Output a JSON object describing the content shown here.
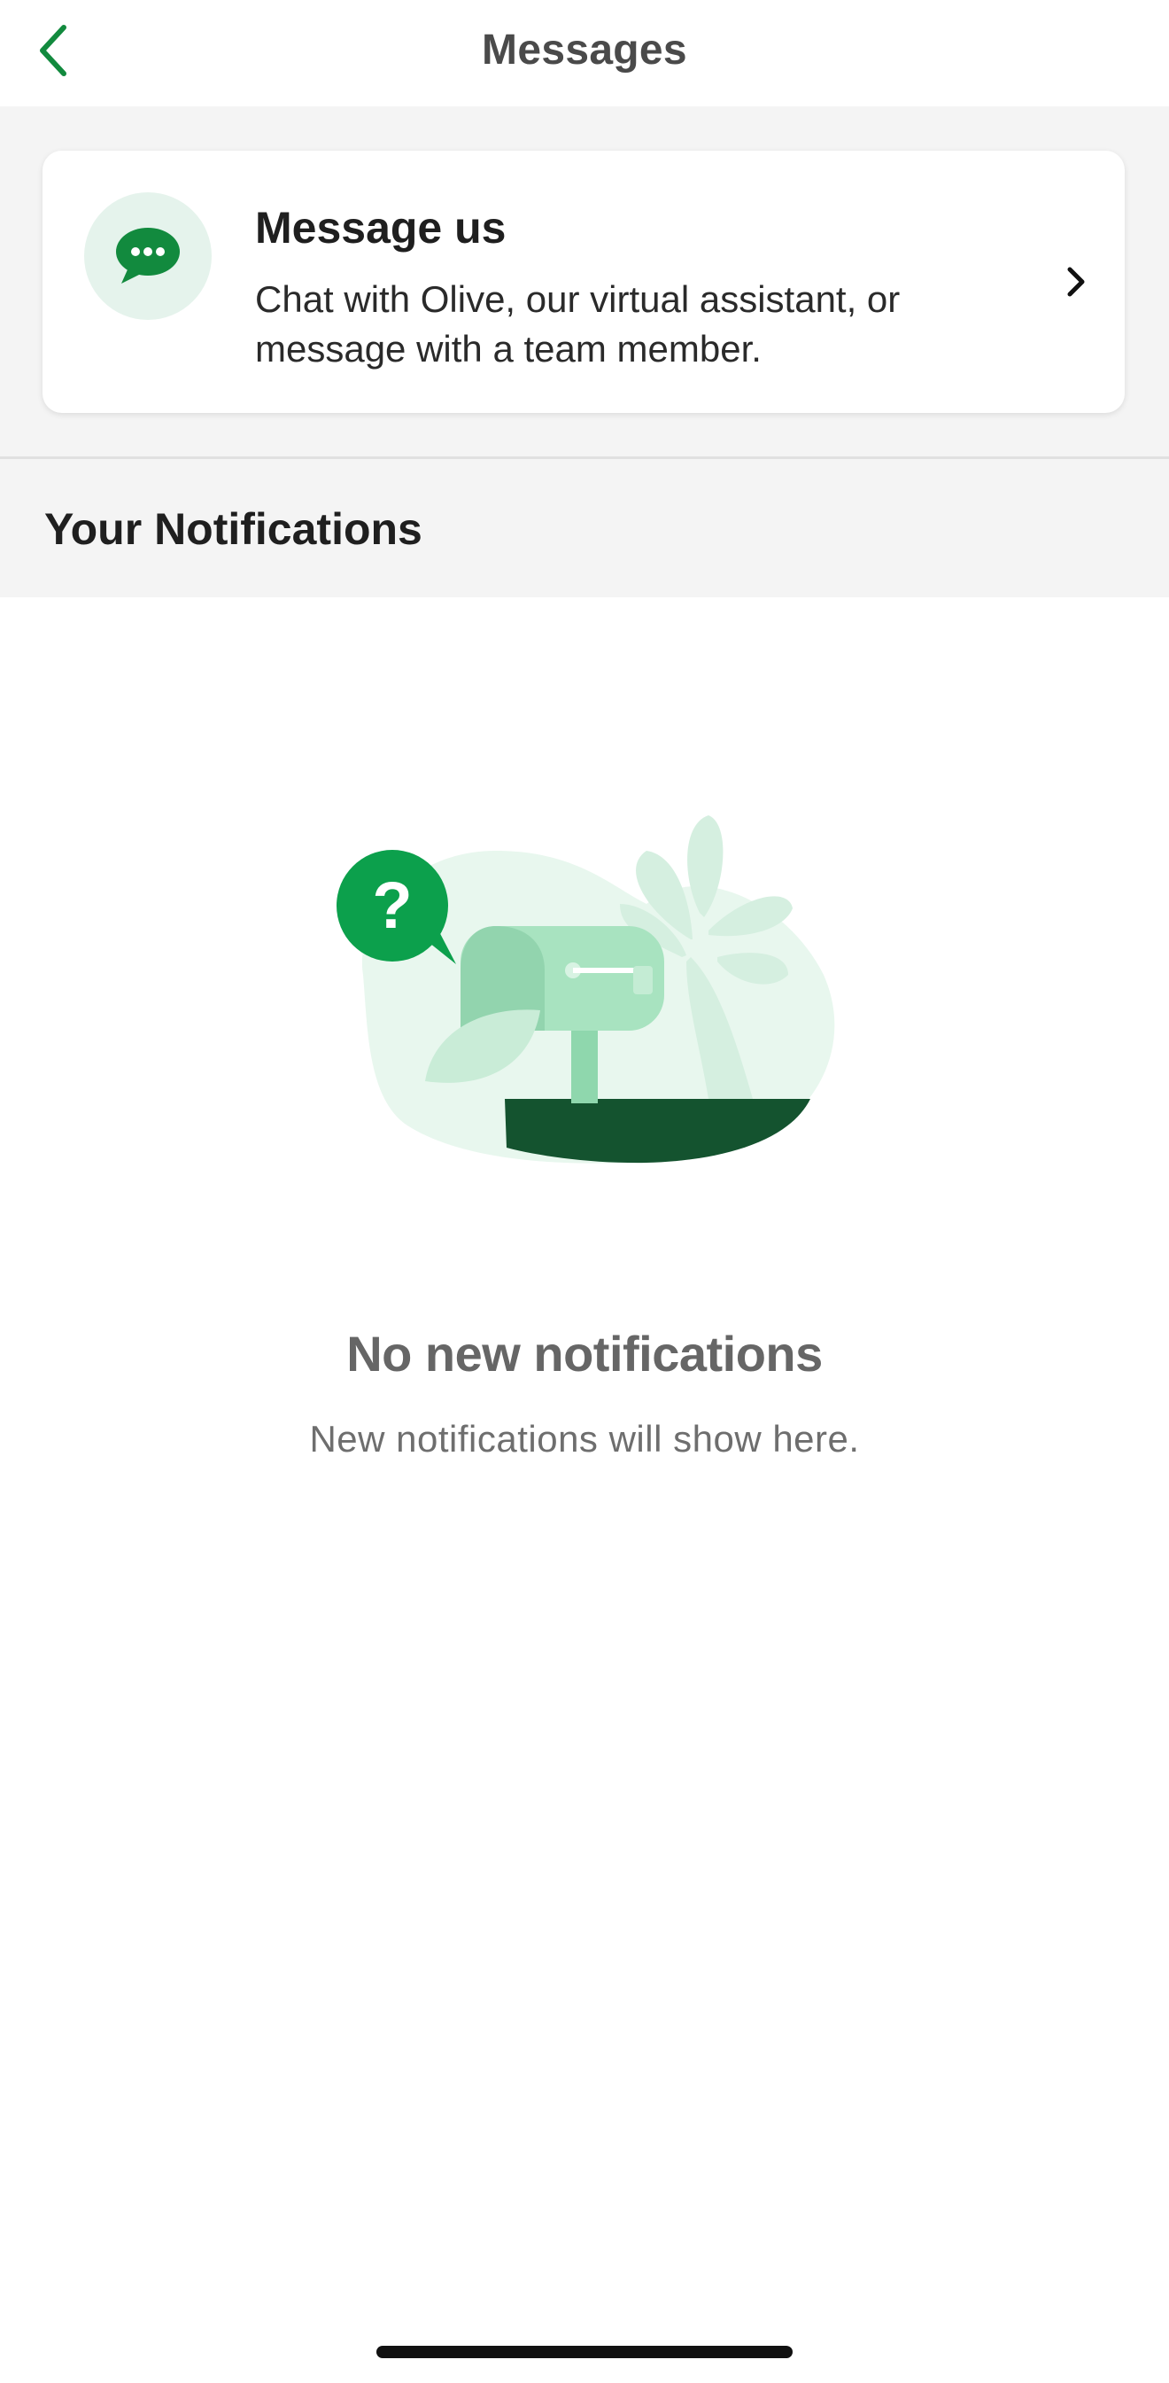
{
  "header": {
    "title": "Messages",
    "back_icon": "chevron-left-icon"
  },
  "message_card": {
    "title": "Message us",
    "description": "Chat with Olive, our virtual assistant, or message with a team member.",
    "icon": "chat-bubble-icon",
    "chevron_icon": "chevron-right-icon"
  },
  "notifications": {
    "section_title": "Your Notifications",
    "empty_title": "No new notifications",
    "empty_subtitle": "New notifications will show here.",
    "illustration": "mailbox-illustration"
  },
  "colors": {
    "accent": "#128a3e",
    "icon_bg": "#e5f3ec",
    "dark_green": "#14532f",
    "section_bg": "#f4f4f4"
  }
}
